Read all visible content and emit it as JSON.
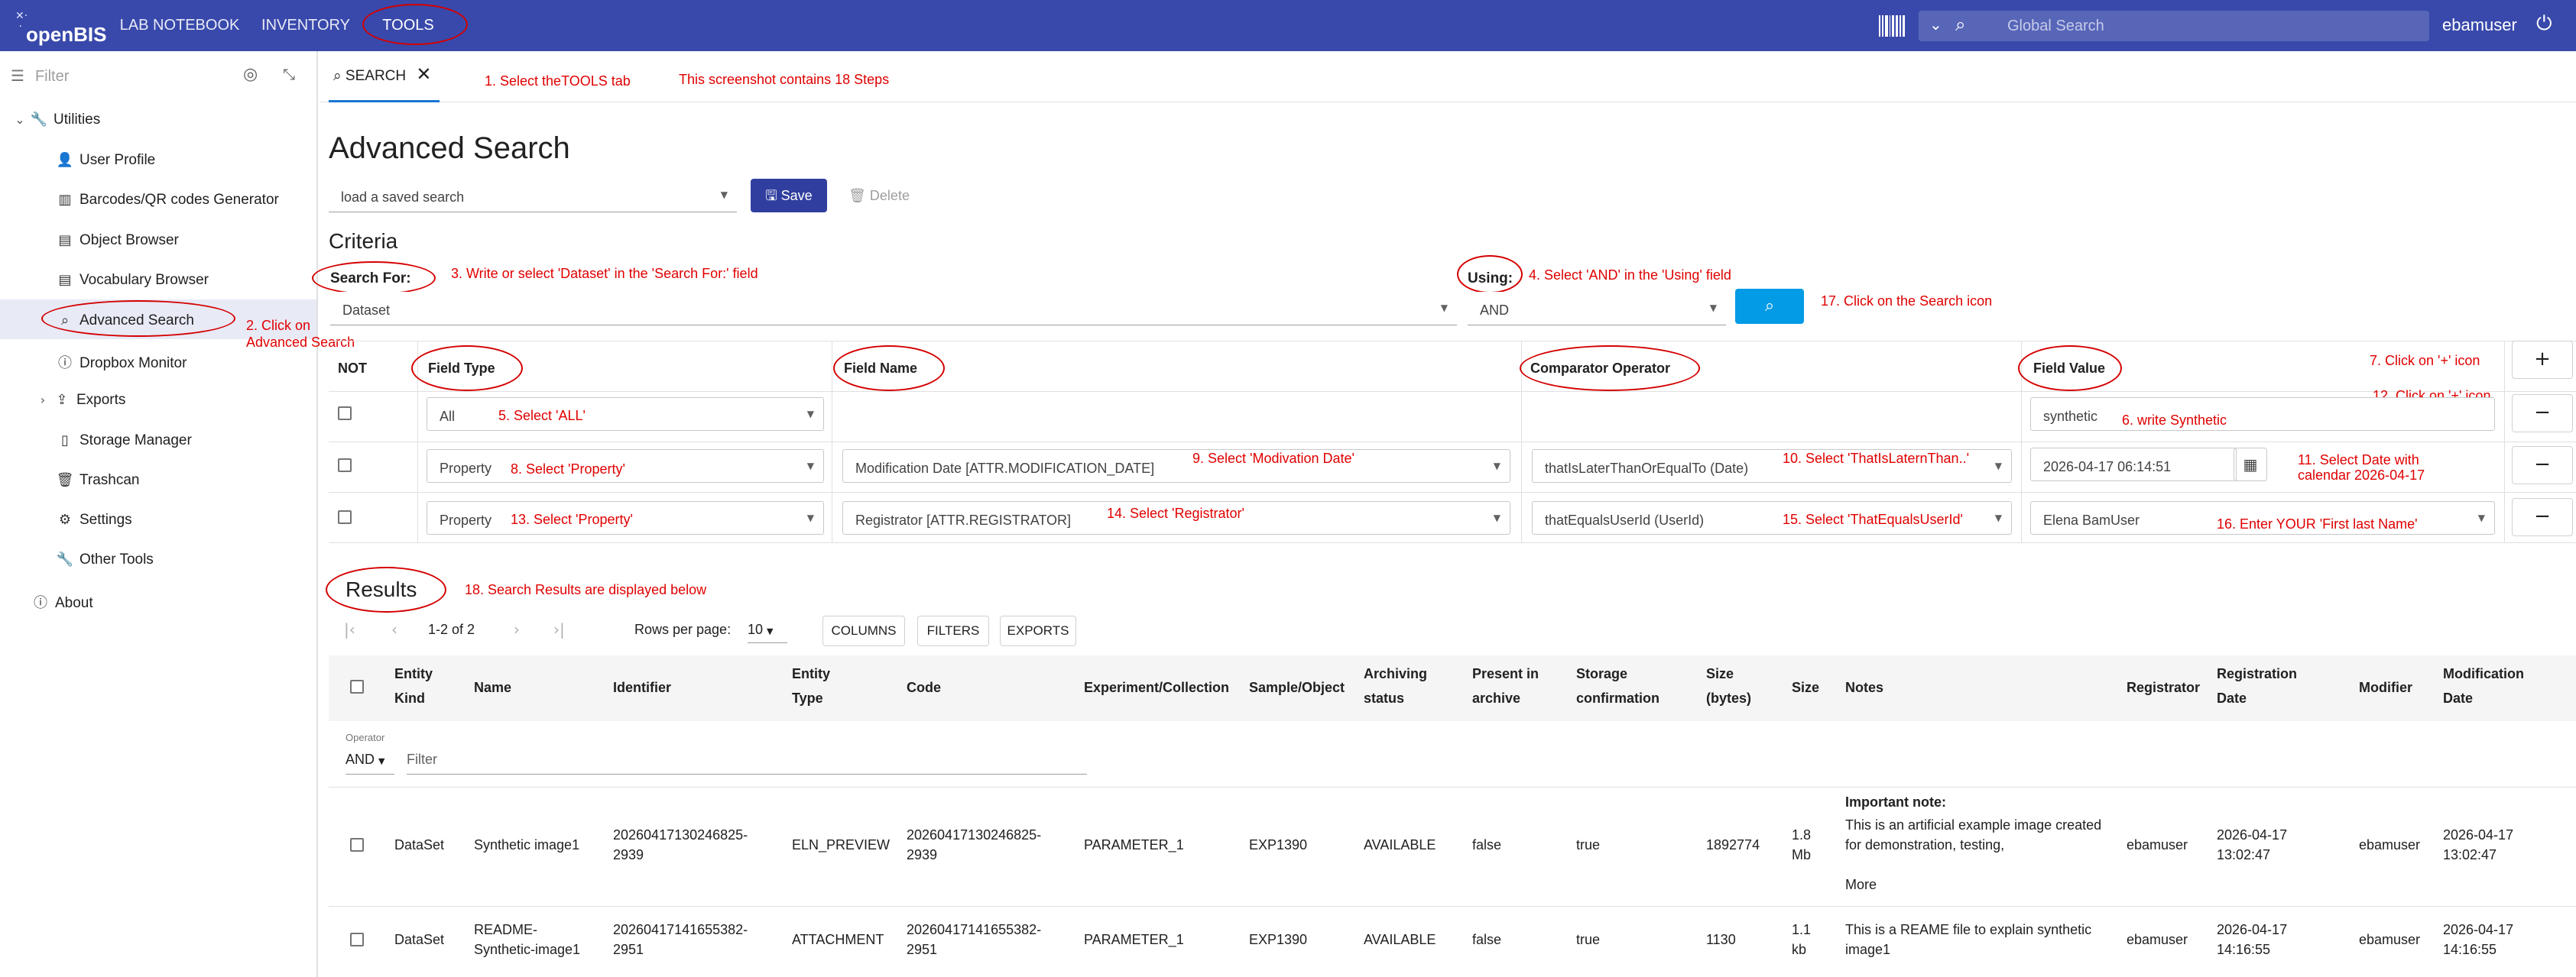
{
  "topbar": {
    "logo": "openBIS",
    "tabs": [
      "LAB NOTEBOOK",
      "INVENTORY",
      "TOOLS"
    ],
    "search_placeholder": "Global Search",
    "user": "ebamuser",
    "accent": "#3949ab"
  },
  "sidebar": {
    "filter_placeholder": "Filter",
    "root": "Utilities",
    "items": [
      "User Profile",
      "Barcodes/QR codes Generator",
      "Object Browser",
      "Vocabulary Browser",
      "Advanced Search",
      "Dropbox Monitor",
      "Exports",
      "Storage Manager",
      "Trashcan",
      "Settings",
      "Other Tools"
    ],
    "about": "About"
  },
  "tab": {
    "label": "SEARCH"
  },
  "page": {
    "title": "Advanced Search",
    "saved_search_placeholder": "load a saved search",
    "save_label": "Save",
    "delete_label": "Delete",
    "criteria_title": "Criteria",
    "search_for_label": "Search For:",
    "search_for_value": "Dataset",
    "using_label": "Using:",
    "using_value": "AND"
  },
  "criteria_table": {
    "headers": [
      "NOT",
      "Field Type",
      "Field Name",
      "Comparator Operator",
      "Field Value"
    ],
    "rows": [
      {
        "field_type": "All",
        "field_name": "",
        "comparator": "",
        "value": "synthetic"
      },
      {
        "field_type": "Property",
        "field_name": "Modification Date [ATTR.MODIFICATION_DATE]",
        "comparator": "thatIsLaterThanOrEqualTo (Date)",
        "value": "2026-04-17 06:14:51"
      },
      {
        "field_type": "Property",
        "field_name": "Registrator [ATTR.REGISTRATOR]",
        "comparator": "thatEqualsUserId (UserId)",
        "value": "Elena BamUser"
      }
    ],
    "add_label": "+",
    "remove_label": "−"
  },
  "annotations": {
    "step1": "1. Select theTOOLS tab",
    "summary": "This screenshot contains 18 Steps",
    "step2a": "2. Click on",
    "step2b": "Advanced Search",
    "step3": "3. Write or select 'Dataset' in the 'Search For:' field",
    "step4": "4. Select 'AND' in the 'Using' field",
    "step5": "5. Select 'ALL'",
    "step6": "6. write Synthetic",
    "step7": "7. Click on '+' icon",
    "step8": "8. Select 'Property'",
    "step9": "9. Select 'Modivation Date'",
    "step10": "10. Select 'ThatIsLaternThan..'",
    "step11a": "11. Select Date with",
    "step11b": "calendar 2026-04-17",
    "step12": "12. Click on '+' icon",
    "step13": "13. Select 'Property'",
    "step14": "14. Select 'Registrator'",
    "step15": "15. Select 'ThatEqualsUserId'",
    "step16": "16. Enter YOUR 'First last Name'",
    "step17": "17. Click on the Search icon",
    "step18": "18. Search Results are displayed below"
  },
  "results": {
    "title": "Results",
    "range": "1-2 of 2",
    "rows_per_page_label": "Rows per page:",
    "rows_per_page": "10",
    "buttons": [
      "COLUMNS",
      "FILTERS",
      "EXPORTS"
    ],
    "operator_label": "Operator",
    "operator_value": "AND",
    "filter_placeholder": "Filter",
    "columns": [
      "Entity Kind",
      "Name",
      "Identifier",
      "Entity Type",
      "Code",
      "Experiment/Collection",
      "Sample/Object",
      "Archiving status",
      "Present in archive",
      "Storage confirmation",
      "Size (bytes)",
      "Size",
      "Notes",
      "Registrator",
      "Registration Date",
      "Modifier",
      "Modification Date"
    ],
    "rows": [
      {
        "kind": "DataSet",
        "name": "Synthetic image1",
        "identifier": "20260417130246825-2939",
        "type": "ELN_PREVIEW",
        "code": "20260417130246825-2939",
        "experiment": "PARAMETER_1",
        "sample": "EXP1390",
        "archiving": "AVAILABLE",
        "present": "false",
        "storage": "true",
        "size_bytes": "1892774",
        "size": "1.8 Mb",
        "notes_title": "Important note:",
        "notes": "This is an artificial example image created for demonstration, testing, documentation, or",
        "more": "More",
        "registrator": "ebamuser",
        "reg_date": "2026-04-17 13:02:47",
        "modifier": "ebamuser",
        "mod_date": "2026-04-17 13:02:47"
      },
      {
        "kind": "DataSet",
        "name": "README-Synthetic-image1",
        "identifier": "20260417141655382-2951",
        "type": "ATTACHMENT",
        "code": "20260417141655382-2951",
        "experiment": "PARAMETER_1",
        "sample": "EXP1390",
        "archiving": "AVAILABLE",
        "present": "false",
        "storage": "true",
        "size_bytes": "1130",
        "size": "1.1 kb",
        "notes_title": "",
        "notes": "This is a REAME file to explain synthetic image1",
        "more": "",
        "registrator": "ebamuser",
        "reg_date": "2026-04-17 14:16:55",
        "modifier": "ebamuser",
        "mod_date": "2026-04-17 14:16:55"
      }
    ]
  }
}
